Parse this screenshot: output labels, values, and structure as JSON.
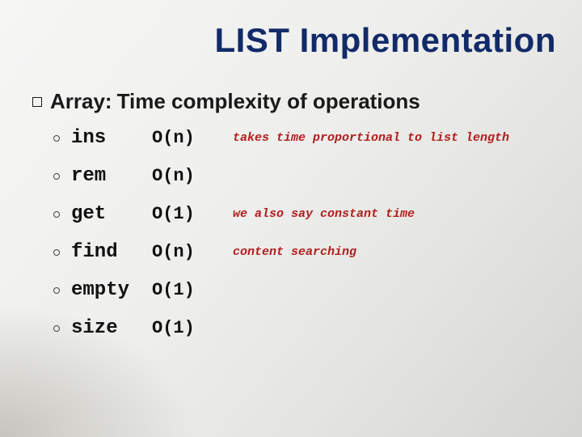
{
  "title": "LIST Implementation",
  "bullet": {
    "label": "Array:",
    "rest": "Time complexity of operations"
  },
  "ops": [
    {
      "name": "ins",
      "complexity": "O(n)",
      "note": "takes time proportional to list length"
    },
    {
      "name": "rem",
      "complexity": "O(n)",
      "note": ""
    },
    {
      "name": "get",
      "complexity": "O(1)",
      "note": "we also say constant time"
    },
    {
      "name": "find",
      "complexity": "O(n)",
      "note": "content searching"
    },
    {
      "name": "empty",
      "complexity": "O(1)",
      "note": ""
    },
    {
      "name": "size",
      "complexity": "O(1)",
      "note": ""
    }
  ]
}
